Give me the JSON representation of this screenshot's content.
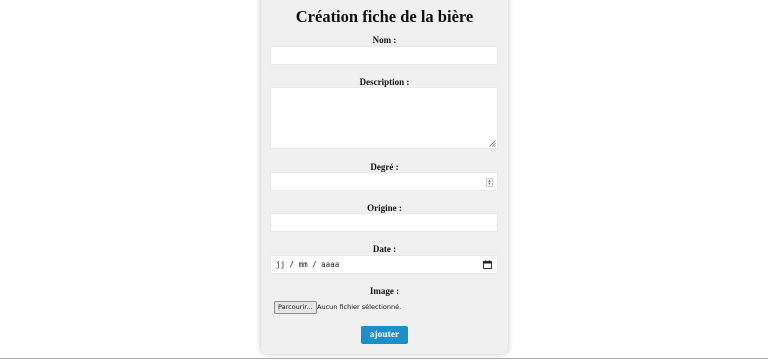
{
  "form": {
    "title": "Création fiche de la bière",
    "name_label": "Nom :",
    "name_value": "",
    "description_label": "Description :",
    "description_value": "",
    "degree_label": "Degré :",
    "degree_value": "",
    "origin_label": "Origine :",
    "origin_value": "",
    "date_label": "Date :",
    "date_placeholder": "jj / mm / aaaa",
    "image_label": "Image :",
    "file_button_label": "Parcourir...",
    "file_status": "Aucun fichier sélectionné.",
    "submit_label": "ajouter"
  },
  "icons": {
    "resize": "resize-grip-icon",
    "spinner": "number-spinner-icon",
    "calendar": "calendar-icon"
  },
  "colors": {
    "card_background": "#f0f0f0",
    "submit_background": "#1a8fc9",
    "submit_text": "#ffffff"
  }
}
